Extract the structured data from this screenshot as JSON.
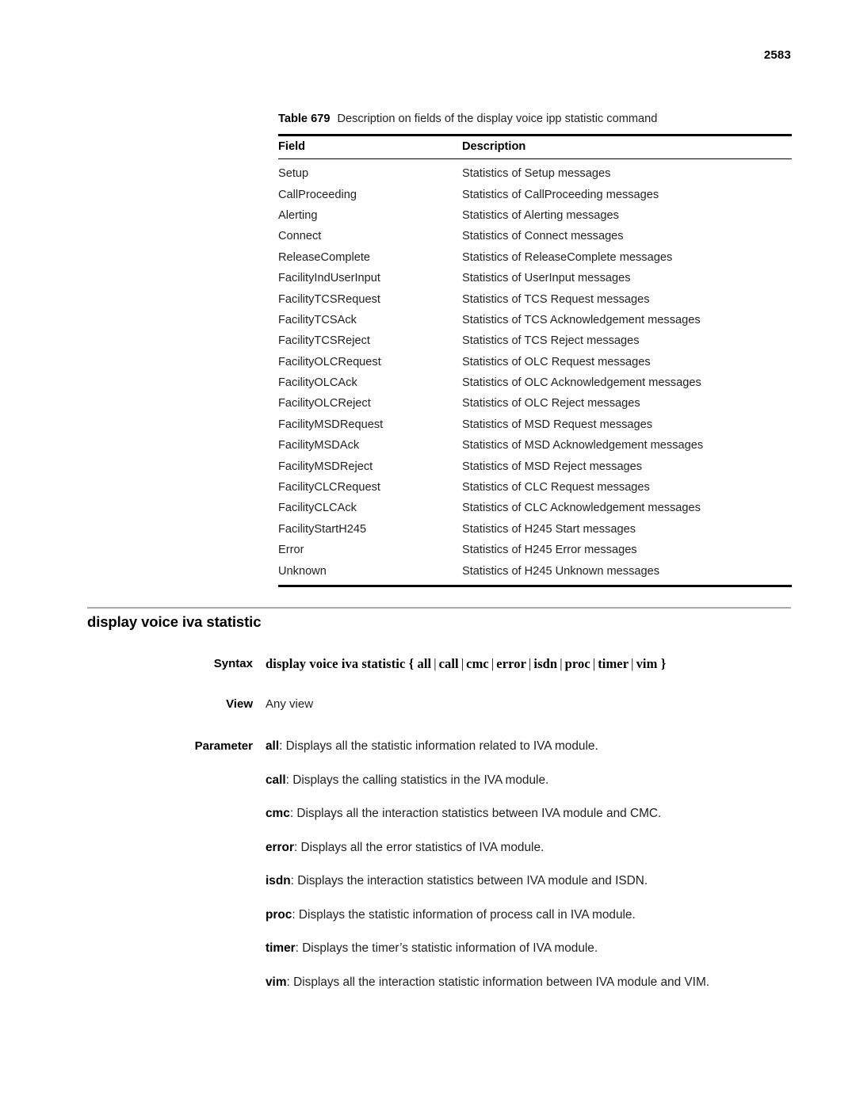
{
  "page": {
    "number": "2583"
  },
  "table": {
    "caption_number": "Table 679",
    "caption_text": "Description on fields of the display voice ipp statistic command",
    "headers": {
      "field": "Field",
      "description": "Description"
    },
    "rows": [
      {
        "field": "Setup",
        "description": "Statistics of Setup messages"
      },
      {
        "field": "CallProceeding",
        "description": "Statistics of CallProceeding messages"
      },
      {
        "field": "Alerting",
        "description": "Statistics of Alerting messages"
      },
      {
        "field": "Connect",
        "description": "Statistics of Connect messages"
      },
      {
        "field": "ReleaseComplete",
        "description": "Statistics of ReleaseComplete messages"
      },
      {
        "field": "FacilityIndUserInput",
        "description": "Statistics of UserInput messages"
      },
      {
        "field": "FacilityTCSRequest",
        "description": "Statistics of TCS Request messages"
      },
      {
        "field": "FacilityTCSAck",
        "description": "Statistics of TCS Acknowledgement messages"
      },
      {
        "field": "FacilityTCSReject",
        "description": "Statistics of TCS Reject messages"
      },
      {
        "field": "FacilityOLCRequest",
        "description": "Statistics of OLC Request messages"
      },
      {
        "field": "FacilityOLCAck",
        "description": "Statistics of OLC Acknowledgement messages"
      },
      {
        "field": "FacilityOLCReject",
        "description": "Statistics of OLC Reject messages"
      },
      {
        "field": "FacilityMSDRequest",
        "description": "Statistics of MSD Request messages"
      },
      {
        "field": "FacilityMSDAck",
        "description": "Statistics of MSD Acknowledgement messages"
      },
      {
        "field": "FacilityMSDReject",
        "description": "Statistics of MSD Reject messages"
      },
      {
        "field": "FacilityCLCRequest",
        "description": "Statistics of CLC Request messages"
      },
      {
        "field": "FacilityCLCAck",
        "description": "Statistics of CLC Acknowledgement messages"
      },
      {
        "field": "FacilityStartH245",
        "description": "Statistics of H245 Start messages"
      },
      {
        "field": "Error",
        "description": "Statistics of H245 Error messages"
      },
      {
        "field": "Unknown",
        "description": "Statistics of H245 Unknown messages"
      }
    ]
  },
  "section": {
    "heading": "display voice iva statistic",
    "syntax": {
      "label": "Syntax",
      "command": "display voice iva statistic",
      "open_brace": "{",
      "options": [
        "all",
        "call",
        "cmc",
        "error",
        "isdn",
        "proc",
        "timer",
        "vim"
      ],
      "close_brace": "}",
      "separator": "|"
    },
    "view": {
      "label": "View",
      "value": "Any view"
    },
    "parameter": {
      "label": "Parameter",
      "items": [
        {
          "term": "all",
          "text": ": Displays all the statistic information related to IVA module."
        },
        {
          "term": "call",
          "text": ": Displays the calling statistics in the IVA module."
        },
        {
          "term": "cmc",
          "text": ": Displays all the interaction statistics between IVA module and CMC."
        },
        {
          "term": "error",
          "text": ": Displays all the error statistics of IVA module."
        },
        {
          "term": "isdn",
          "text": ": Displays the interaction statistics between IVA module and ISDN."
        },
        {
          "term": "proc",
          "text": ": Displays the statistic information of process call in IVA module."
        },
        {
          "term": "timer",
          "text": ": Displays the timer’s statistic information of IVA module."
        },
        {
          "term": "vim",
          "text": ": Displays all the interaction statistic information between IVA module and VIM."
        }
      ]
    }
  }
}
